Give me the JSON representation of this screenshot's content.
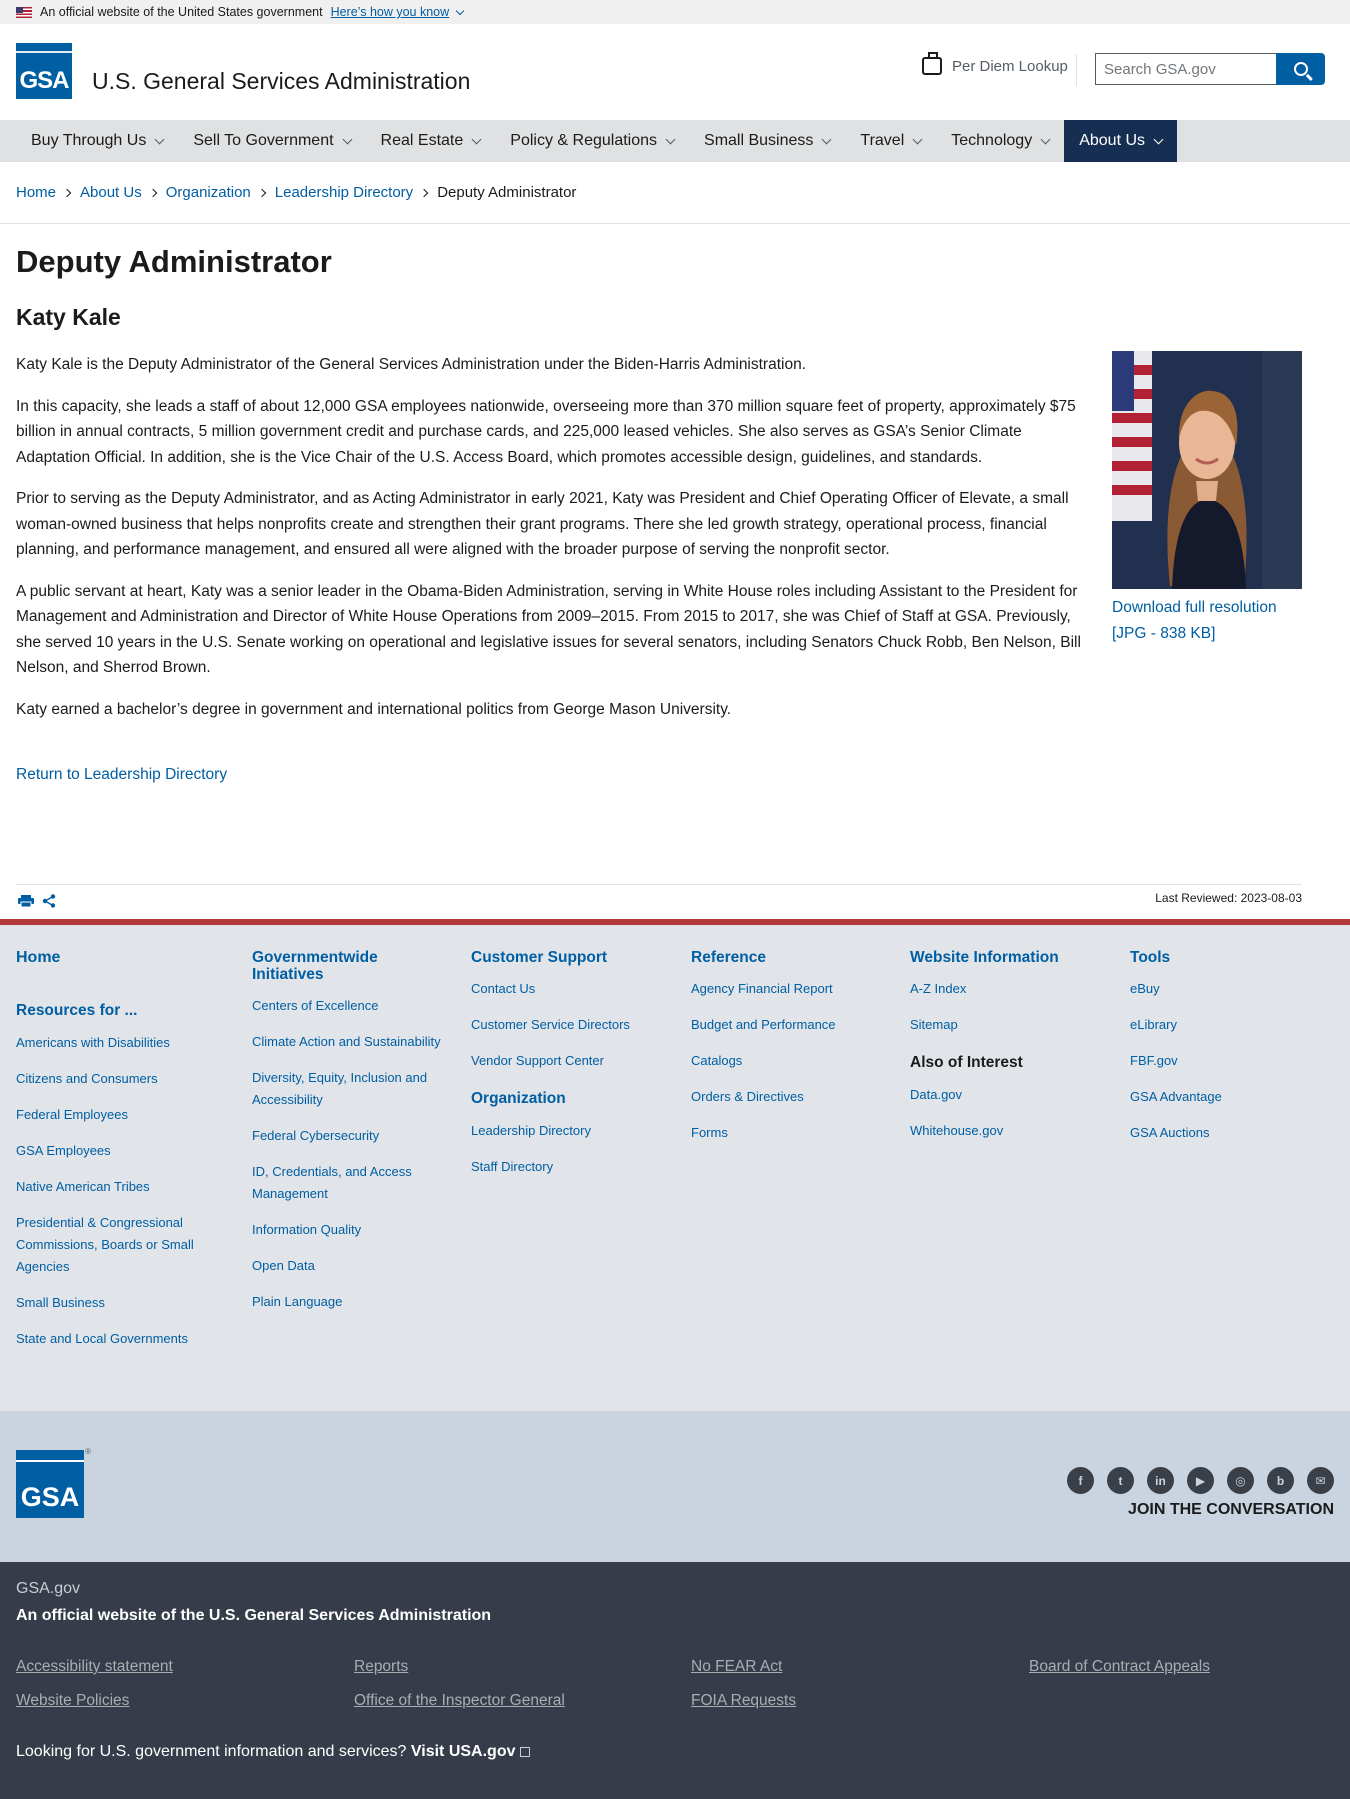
{
  "banner": {
    "text": "An official website of the United States government",
    "link": "Here’s how you know"
  },
  "header": {
    "logo_text": "GSA",
    "site_title": "U.S. General Services Administration",
    "per_diem": "Per Diem Lookup",
    "search_placeholder": "Search GSA.gov"
  },
  "nav": {
    "items": [
      {
        "label": "Buy Through Us"
      },
      {
        "label": "Sell To Government"
      },
      {
        "label": "Real Estate"
      },
      {
        "label": "Policy & Regulations"
      },
      {
        "label": "Small Business"
      },
      {
        "label": "Travel"
      },
      {
        "label": "Technology"
      },
      {
        "label": "About Us"
      }
    ],
    "active": "About Us"
  },
  "breadcrumb": {
    "items": [
      "Home",
      "About Us",
      "Organization",
      "Leadership Directory"
    ],
    "current": "Deputy Administrator"
  },
  "main": {
    "title": "Deputy Administrator",
    "name": "Katy Kale",
    "paragraphs": [
      "Katy Kale is the Deputy Administrator of the General Services Administration under the Biden-Harris Administration.",
      "In this capacity, she leads a staff of about 12,000 GSA employees nationwide, overseeing more than 370 million square feet of property, approximately $75 billion in annual contracts, 5 million government credit and purchase cards, and 225,000 leased vehicles. She also serves as GSA’s Senior Climate Adaptation Official. In addition, she is the Vice Chair of the U.S. Access Board, which promotes accessible design, guidelines, and standards.",
      "Prior to serving as the Deputy Administrator, and as Acting Administrator in early 2021, Katy was President and Chief Operating Officer of Elevate, a small woman-owned business that helps nonprofits create and strengthen their grant programs. There she led growth strategy, operational process, financial planning, and performance management, and ensured all were aligned with the broader purpose of serving the nonprofit sector.",
      "A public servant at heart, Katy was a senior leader in the Obama-Biden Administration, serving in White House roles including Assistant to the President for Management and Administration and Director of White House Operations from 2009–2015. From 2015 to 2017, she was Chief of Staff at GSA. Previously, she served 10 years in the U.S. Senate working on operational and legislative issues for several senators, including Senators Chuck Robb, Ben Nelson, Bill Nelson, and Sherrod Brown.",
      "Katy earned a bachelor’s degree in government and international politics from George Mason University."
    ],
    "download_link": "Download full resolution [JPG - 838 KB]",
    "return_link": "Return to Leadership Directory",
    "last_reviewed": "Last Reviewed: 2023-08-03"
  },
  "footer": {
    "home": "Home",
    "resources_heading": "Resources for ...",
    "resources": [
      "Americans with Disabilities",
      "Citizens and Consumers",
      "Federal Employees",
      "GSA Employees",
      "Native American Tribes",
      "Presidential & Congressional Commissions, Boards or Small Agencies",
      "Small Business",
      "State and Local Governments"
    ],
    "governmentwide_heading": "Governmentwide Initiatives",
    "governmentwide": [
      "Centers of Excellence",
      "Climate Action and Sustainability",
      "Diversity, Equity, Inclusion and Accessibility",
      "Federal Cybersecurity",
      "ID, Credentials, and Access Management",
      "Information Quality",
      "Open Data",
      "Plain Language"
    ],
    "customer_support_heading": "Customer Support",
    "customer_support": [
      "Contact Us",
      "Customer Service Directors",
      "Vendor Support Center"
    ],
    "organization_heading": "Organization",
    "organization": [
      "Leadership Directory",
      "Staff Directory"
    ],
    "reference_heading": "Reference",
    "reference": [
      "Agency Financial Report",
      "Budget and Performance",
      "Catalogs",
      "Orders & Directives",
      "Forms"
    ],
    "website_info_heading": "Website Information",
    "website_info": [
      "A-Z Index",
      "Sitemap"
    ],
    "also_heading": "Also of Interest",
    "also": [
      "Data.gov",
      "Whitehouse.gov"
    ],
    "tools_heading": "Tools",
    "tools": [
      "eBuy",
      "eLibrary",
      "FBF.gov",
      "GSA Advantage",
      "GSA Auctions"
    ]
  },
  "social": {
    "logo_text": "GSA",
    "icons": [
      "facebook-icon",
      "twitter-icon",
      "linkedin-icon",
      "youtube-icon",
      "instagram-icon",
      "blog-icon",
      "email-icon"
    ],
    "join": "JOIN THE CONVERSATION"
  },
  "identifier": {
    "domain": "GSA.gov",
    "description": "An official website of the U.S. General Services Administration",
    "links": [
      "Accessibility statement",
      "Reports",
      "No FEAR Act",
      "Board of Contract Appeals",
      "Website Policies",
      "Office of the Inspector General",
      "FOIA Requests"
    ],
    "usa_prefix": "Looking for U.S. government information and services?",
    "usa_link": "Visit USA.gov"
  },
  "colors": {
    "primary": "#005ea2",
    "nav_active": "#162e51",
    "footer_rule": "#b5393c",
    "identifier_bg": "#363c49"
  }
}
